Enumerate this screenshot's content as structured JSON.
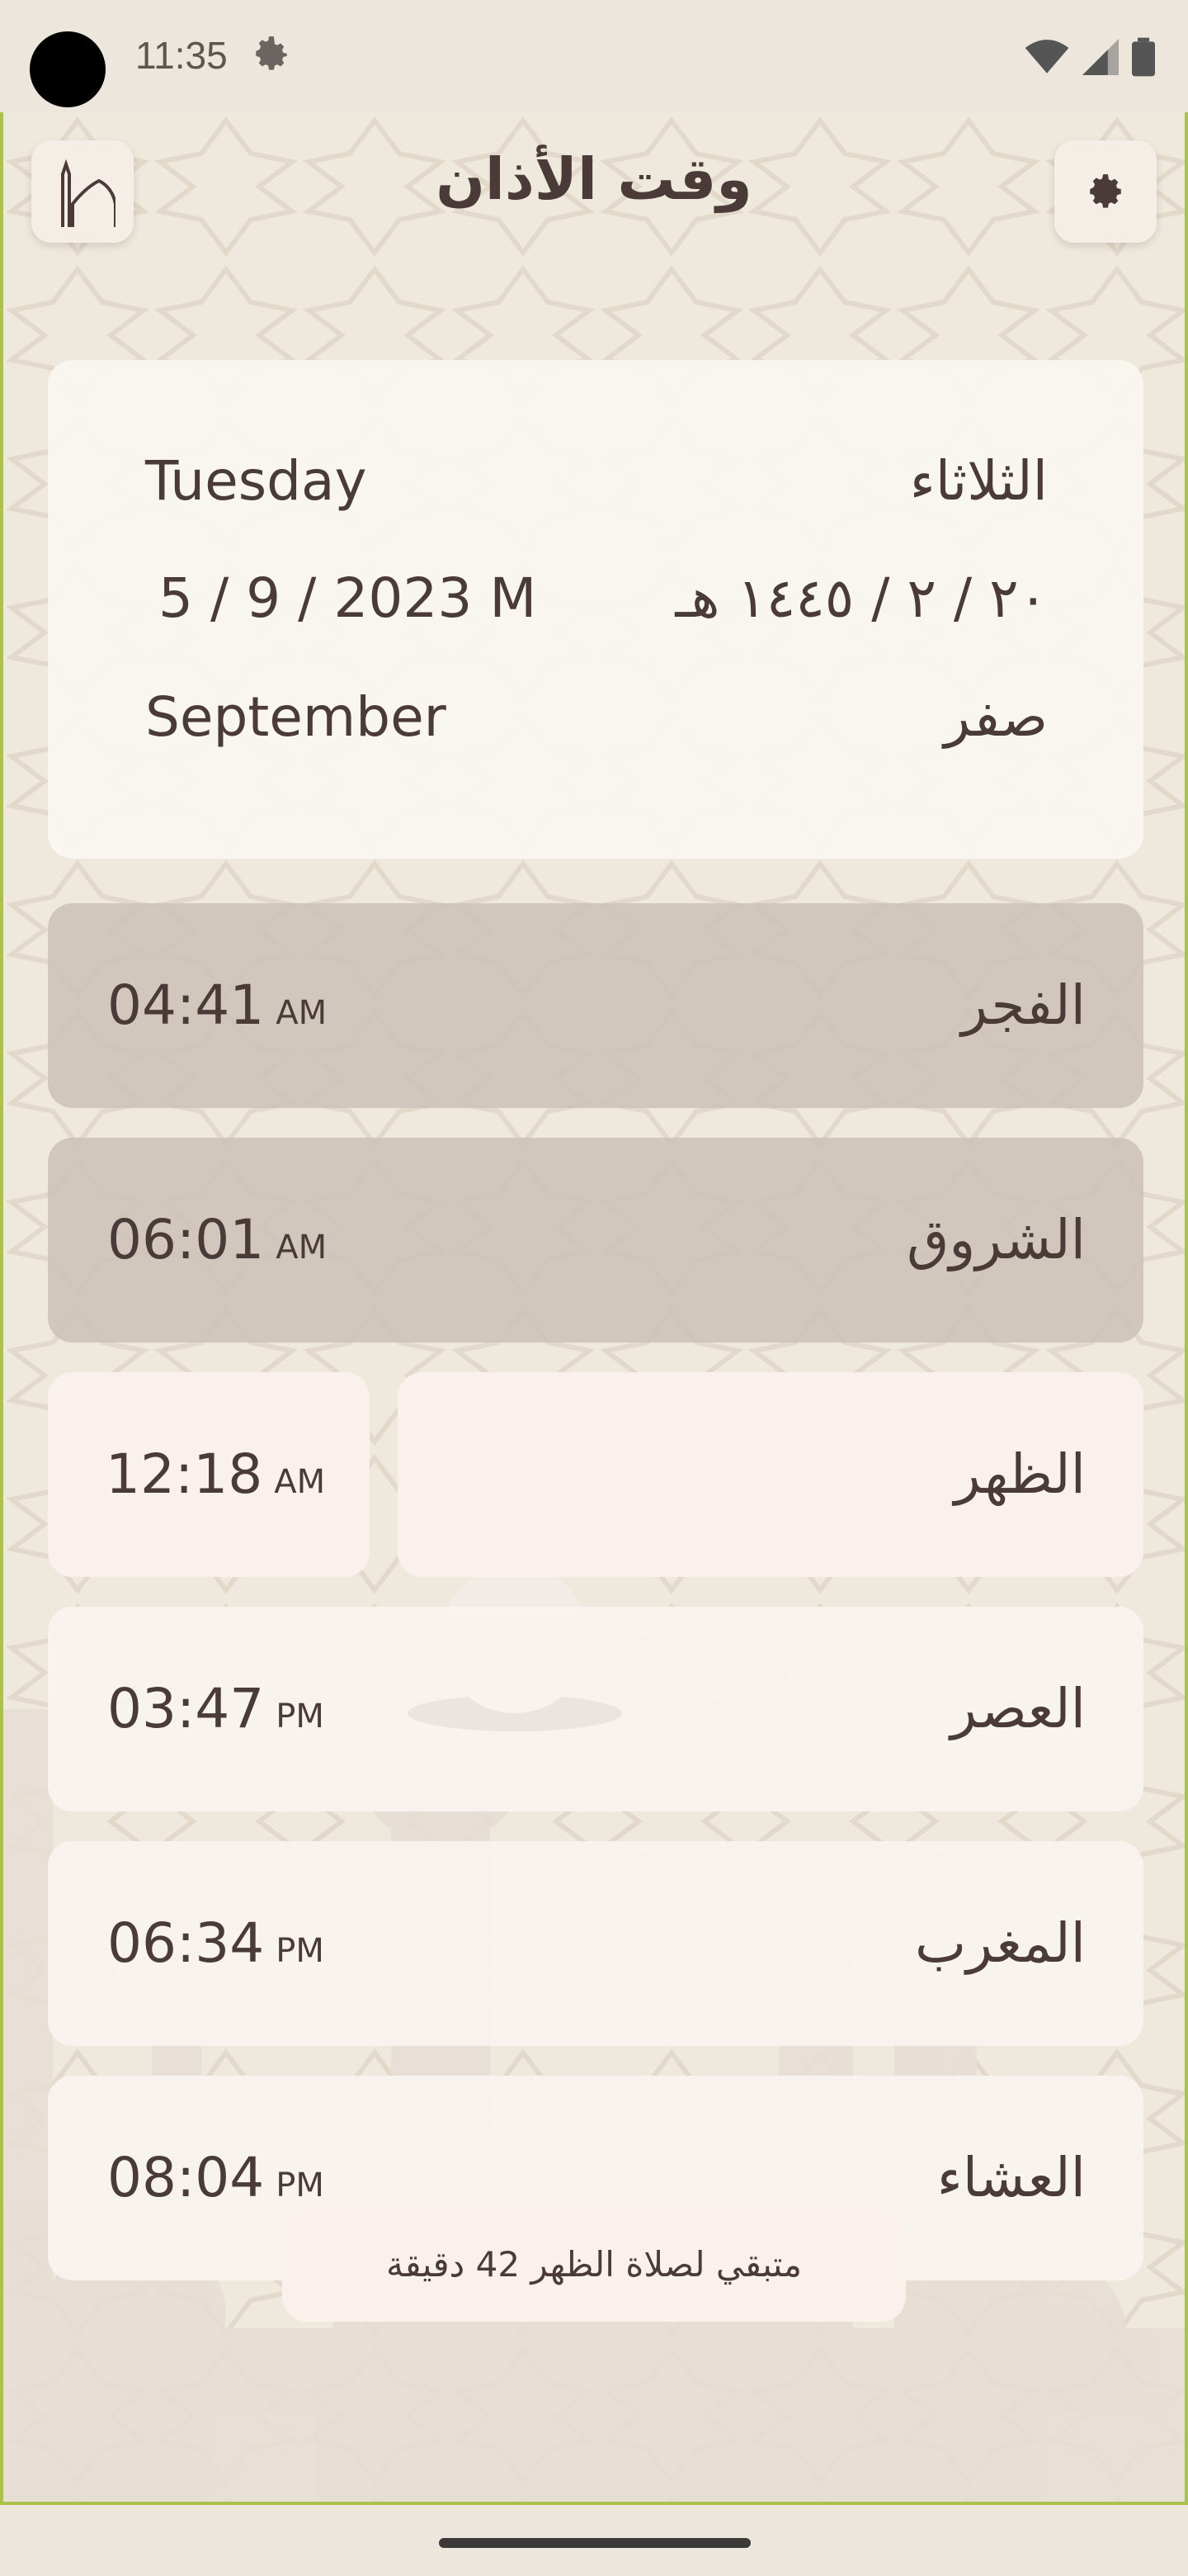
{
  "status_bar": {
    "time": "11:35",
    "icons": [
      "settings-gear-icon",
      "wifi-icon",
      "signal-icon",
      "battery-icon"
    ]
  },
  "header": {
    "title": "وقت الأذان",
    "left_icon": "mosque-icon",
    "right_icon": "settings-icon"
  },
  "date_card": {
    "weekday_en": "Tuesday",
    "weekday_ar": "الثلاثاء",
    "gregorian_date": "5 / 9 / 2023 M",
    "hijri_date": "٢٠ / ٢ / ١٤٤٥ هـ",
    "month_en": "September",
    "month_ar": "صفر"
  },
  "prayers": [
    {
      "name": "الفجر",
      "time": "04:41",
      "ampm": "AM",
      "state": "past"
    },
    {
      "name": "الشروق",
      "time": "06:01",
      "ampm": "AM",
      "state": "past"
    },
    {
      "name": "الظهر",
      "time": "12:18",
      "ampm": "AM",
      "state": "next"
    },
    {
      "name": "العصر",
      "time": "03:47",
      "ampm": "PM",
      "state": "upcoming"
    },
    {
      "name": "المغرب",
      "time": "06:34",
      "ampm": "PM",
      "state": "upcoming"
    },
    {
      "name": "العشاء",
      "time": "08:04",
      "ampm": "PM",
      "state": "upcoming"
    }
  ],
  "countdown": "متبقي لصلاة الظهر 42 دقيقة",
  "colors": {
    "accent_border": "#a8c24a",
    "text": "#4a3b39",
    "past_row": "#cdc2b8",
    "current_row": "#faf1ec"
  }
}
